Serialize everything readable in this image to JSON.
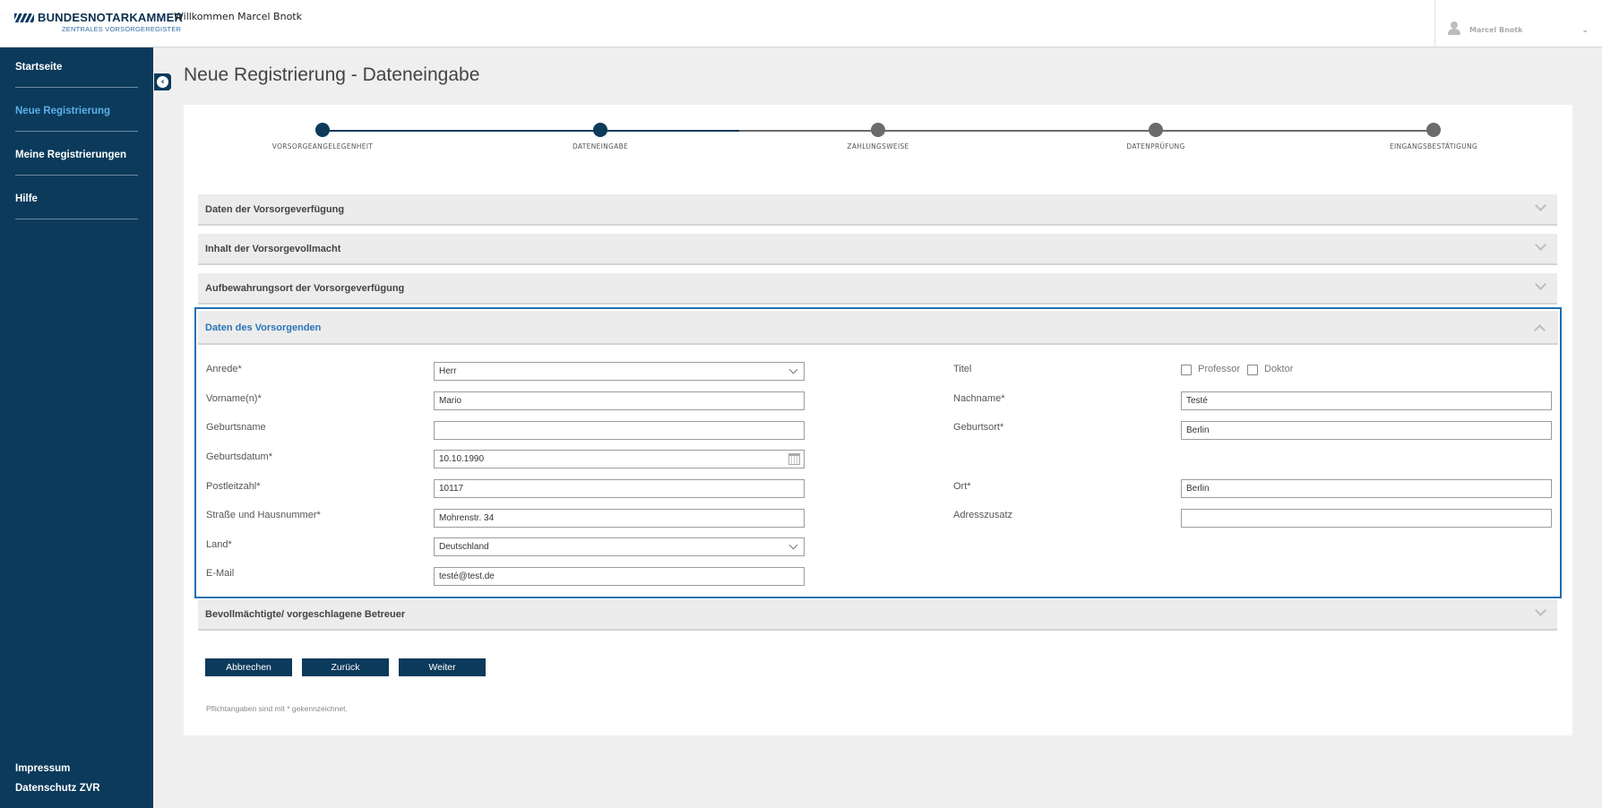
{
  "header": {
    "brand_name": "BUNDESNOTARKAMMER",
    "brand_sub": "ZENTRALES VORSORGEREGISTER",
    "welcome": "Willkommen Marcel Bnotk",
    "user_name": "Marcel Bnotk"
  },
  "sidebar": {
    "items": [
      {
        "label": "Startseite",
        "active": false
      },
      {
        "label": "Neue Registrierung",
        "active": true
      },
      {
        "label": "Meine Registrierungen",
        "active": false
      },
      {
        "label": "Hilfe",
        "active": false
      }
    ],
    "footer": [
      "Impressum",
      "Datenschutz ZVR"
    ]
  },
  "page_title": "Neue Registrierung - Dateneingabe",
  "stepper": {
    "steps": [
      "VORSORGEANGELEGENHEIT",
      "DATENEINGABE",
      "ZAHLUNGSWEISE",
      "DATENPRÜFUNG",
      "EINGANGSBESTÄTIGUNG"
    ],
    "current_step": 2
  },
  "sections": {
    "s1": "Daten der Vorsorgeverfügung",
    "s2": "Inhalt der Vorsorgevollmacht",
    "s3": "Aufbewahrungsort der Vorsorgeverfügung",
    "s4": "Daten des Vorsorgenden",
    "s5": "Bevollmächtigte/ vorgeschlagene Betreuer"
  },
  "form": {
    "anrede": {
      "label": "Anrede*",
      "value": "Herr"
    },
    "titel": {
      "label": "Titel",
      "opt1": "Professor",
      "opt2": "Doktor"
    },
    "vorname": {
      "label": "Vorname(n)*",
      "value": "Mario"
    },
    "nachname": {
      "label": "Nachname*",
      "value": "Testé"
    },
    "geburtsname": {
      "label": "Geburtsname",
      "value": ""
    },
    "geburtsort": {
      "label": "Geburtsort*",
      "value": "Berlin"
    },
    "geburtsdatum": {
      "label": "Geburtsdatum*",
      "value": "10.10.1990"
    },
    "plz": {
      "label": "Postleitzahl*",
      "value": "10117"
    },
    "ort": {
      "label": "Ort*",
      "value": "Berlin"
    },
    "strasse": {
      "label": "Straße und Hausnummer*",
      "value": "Mohrenstr. 34"
    },
    "adresszusatz": {
      "label": "Adresszusatz",
      "value": ""
    },
    "land": {
      "label": "Land*",
      "value": "Deutschland"
    },
    "email": {
      "label": "E-Mail",
      "value": "testé@test.de"
    }
  },
  "buttons": {
    "cancel": "Abbrechen",
    "back": "Zurück",
    "next": "Weiter"
  },
  "note": "Pflichtangaben sind mit * gekennzeichnet.",
  "colors": {
    "primary": "#0b3a5b",
    "active_link": "#5bb1e8",
    "section_active": "#2a74b8",
    "step_inactive": "#6b6b6b"
  }
}
